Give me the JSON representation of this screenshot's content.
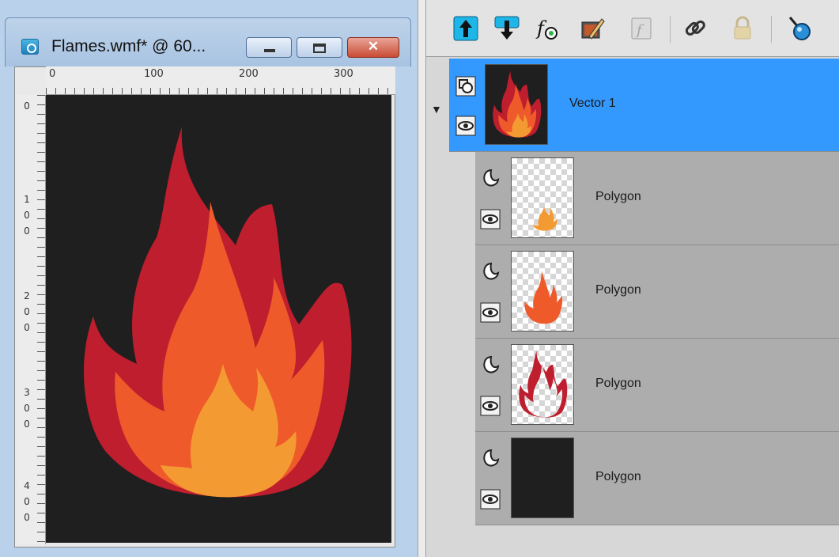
{
  "document_window": {
    "title": "Flames.wmf* @ 60...",
    "buttons": {
      "minimize": "minimize-button",
      "maximize": "maximize-button",
      "close": "close-button"
    },
    "close_glyph": "✕",
    "ruler_top_labels": [
      "0",
      "100",
      "200",
      "300"
    ],
    "ruler_left_labels": [
      [
        "0"
      ],
      [
        "1",
        "0",
        "0"
      ],
      [
        "2",
        "0",
        "0"
      ],
      [
        "3",
        "0",
        "0"
      ],
      [
        "4",
        "0",
        "0"
      ]
    ],
    "canvas_background": "#1f1f1f",
    "flame_colors": {
      "outer": "#be1e2d",
      "middle": "#ef5a2a",
      "inner": "#f49a33"
    }
  },
  "layers_toolbar": {
    "tools": [
      "move-layer-up-icon",
      "move-layer-down-icon",
      "layer-effects-icon",
      "edit-layer-icon",
      "script-icon",
      "link-icon",
      "lock-icon",
      "pin-icon"
    ]
  },
  "layers": [
    {
      "name": "Vector 1",
      "type": "group",
      "selected": true,
      "visible": true
    },
    {
      "name": "Polygon",
      "type": "vector",
      "selected": false,
      "visible": true,
      "thumb": "inner-flame"
    },
    {
      "name": "Polygon",
      "type": "vector",
      "selected": false,
      "visible": true,
      "thumb": "middle-flame"
    },
    {
      "name": "Polygon",
      "type": "vector",
      "selected": false,
      "visible": true,
      "thumb": "outer-flame"
    },
    {
      "name": "Polygon",
      "type": "vector",
      "selected": false,
      "visible": true,
      "thumb": "background"
    }
  ],
  "colors": {
    "selection": "#3399ff",
    "layer_row": "#adadad"
  }
}
